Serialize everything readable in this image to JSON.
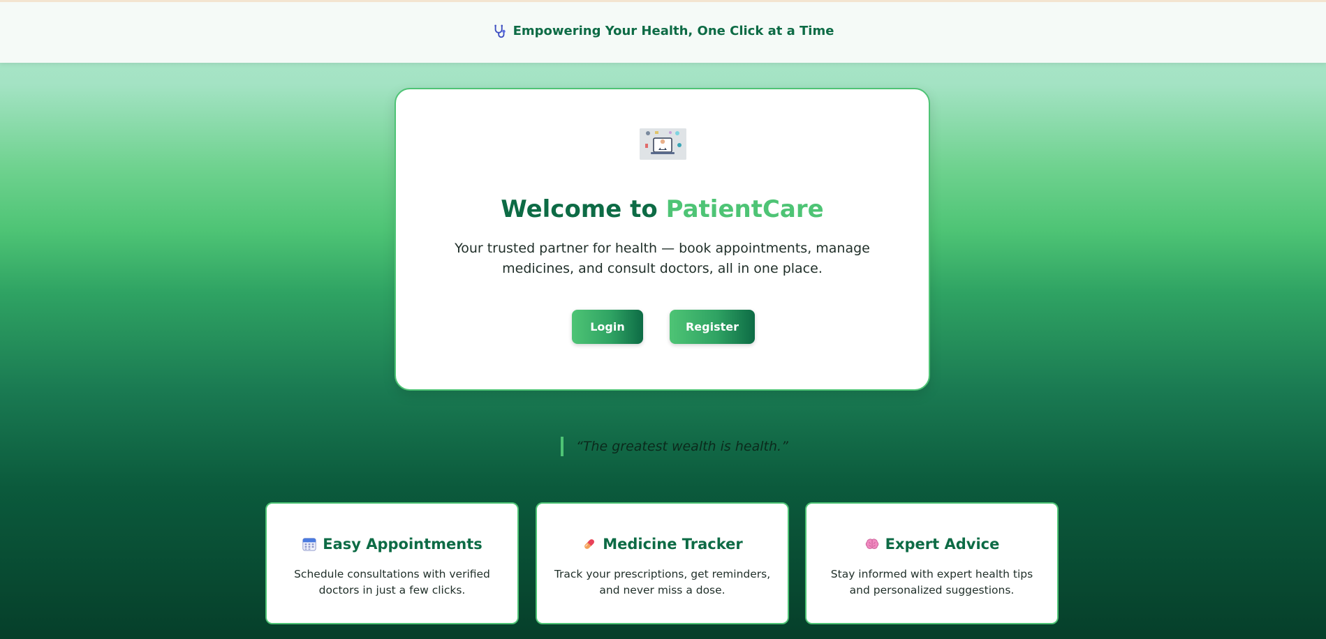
{
  "header": {
    "tagline": "Empowering Your Health, One Click at a Time",
    "tagline_icon": "stethoscope-icon"
  },
  "hero": {
    "image_icon": "doctor-consultation-illustration",
    "welcome_prefix": "Welcome to ",
    "brand_name": "PatientCare",
    "intro": "Your trusted partner for health — book appointments, manage medicines, and consult doctors, all in one place.",
    "login_label": "Login",
    "register_label": "Register"
  },
  "quote": {
    "text": "“The greatest wealth is health.”"
  },
  "features": [
    {
      "icon": "calendar-icon",
      "title": "Easy Appointments",
      "description": "Schedule consultations with verified doctors in just a few clicks."
    },
    {
      "icon": "pill-icon",
      "title": "Medicine Tracker",
      "description": "Track your prescriptions, get reminders, and never miss a dose."
    },
    {
      "icon": "brain-icon",
      "title": "Expert Advice",
      "description": "Stay informed with expert health tips and personalized suggestions."
    }
  ],
  "colors": {
    "primary": "#0d6b45",
    "accent": "#4ec475",
    "card_border": "#4ec475"
  }
}
